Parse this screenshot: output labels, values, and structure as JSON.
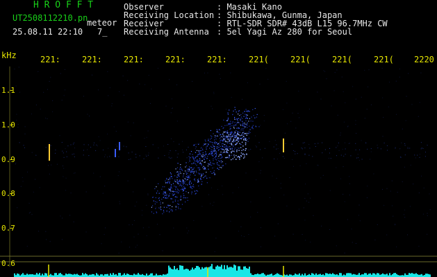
{
  "header": {
    "title": "H R O F F T",
    "file_name": "UT2508112210.pn",
    "tag": "meteor",
    "datetime": "25.08.11 22:10",
    "frame": "7_"
  },
  "info": [
    {
      "label": "Observer",
      "value": ": Masaki Kano"
    },
    {
      "label": "Receiving Location",
      "value": ": Shibukawa, Gunma, Japan"
    },
    {
      "label": "Receiver",
      "value": ": RTL-SDR SDR# 43dB L15 96.7MHz CW"
    },
    {
      "label": "Receiving Antenna",
      "value": ": 5el Yagi Az 280 for Seoul"
    }
  ],
  "axis": {
    "unit": "kHz",
    "x_ticks": [
      "221:",
      "221:",
      "221:",
      "221:",
      "221:",
      "221(",
      "221(",
      "221(",
      "221(",
      "2220"
    ],
    "y_ticks": [
      "1.1",
      "1.0",
      "0.9",
      "0.8",
      "0.7",
      "0.6"
    ]
  },
  "colors": {
    "label_yellow": "#e6e600",
    "title_green": "#19d119",
    "echo_blue": "#3a5cff",
    "spectrum_cyan": "#19e6e6"
  }
}
